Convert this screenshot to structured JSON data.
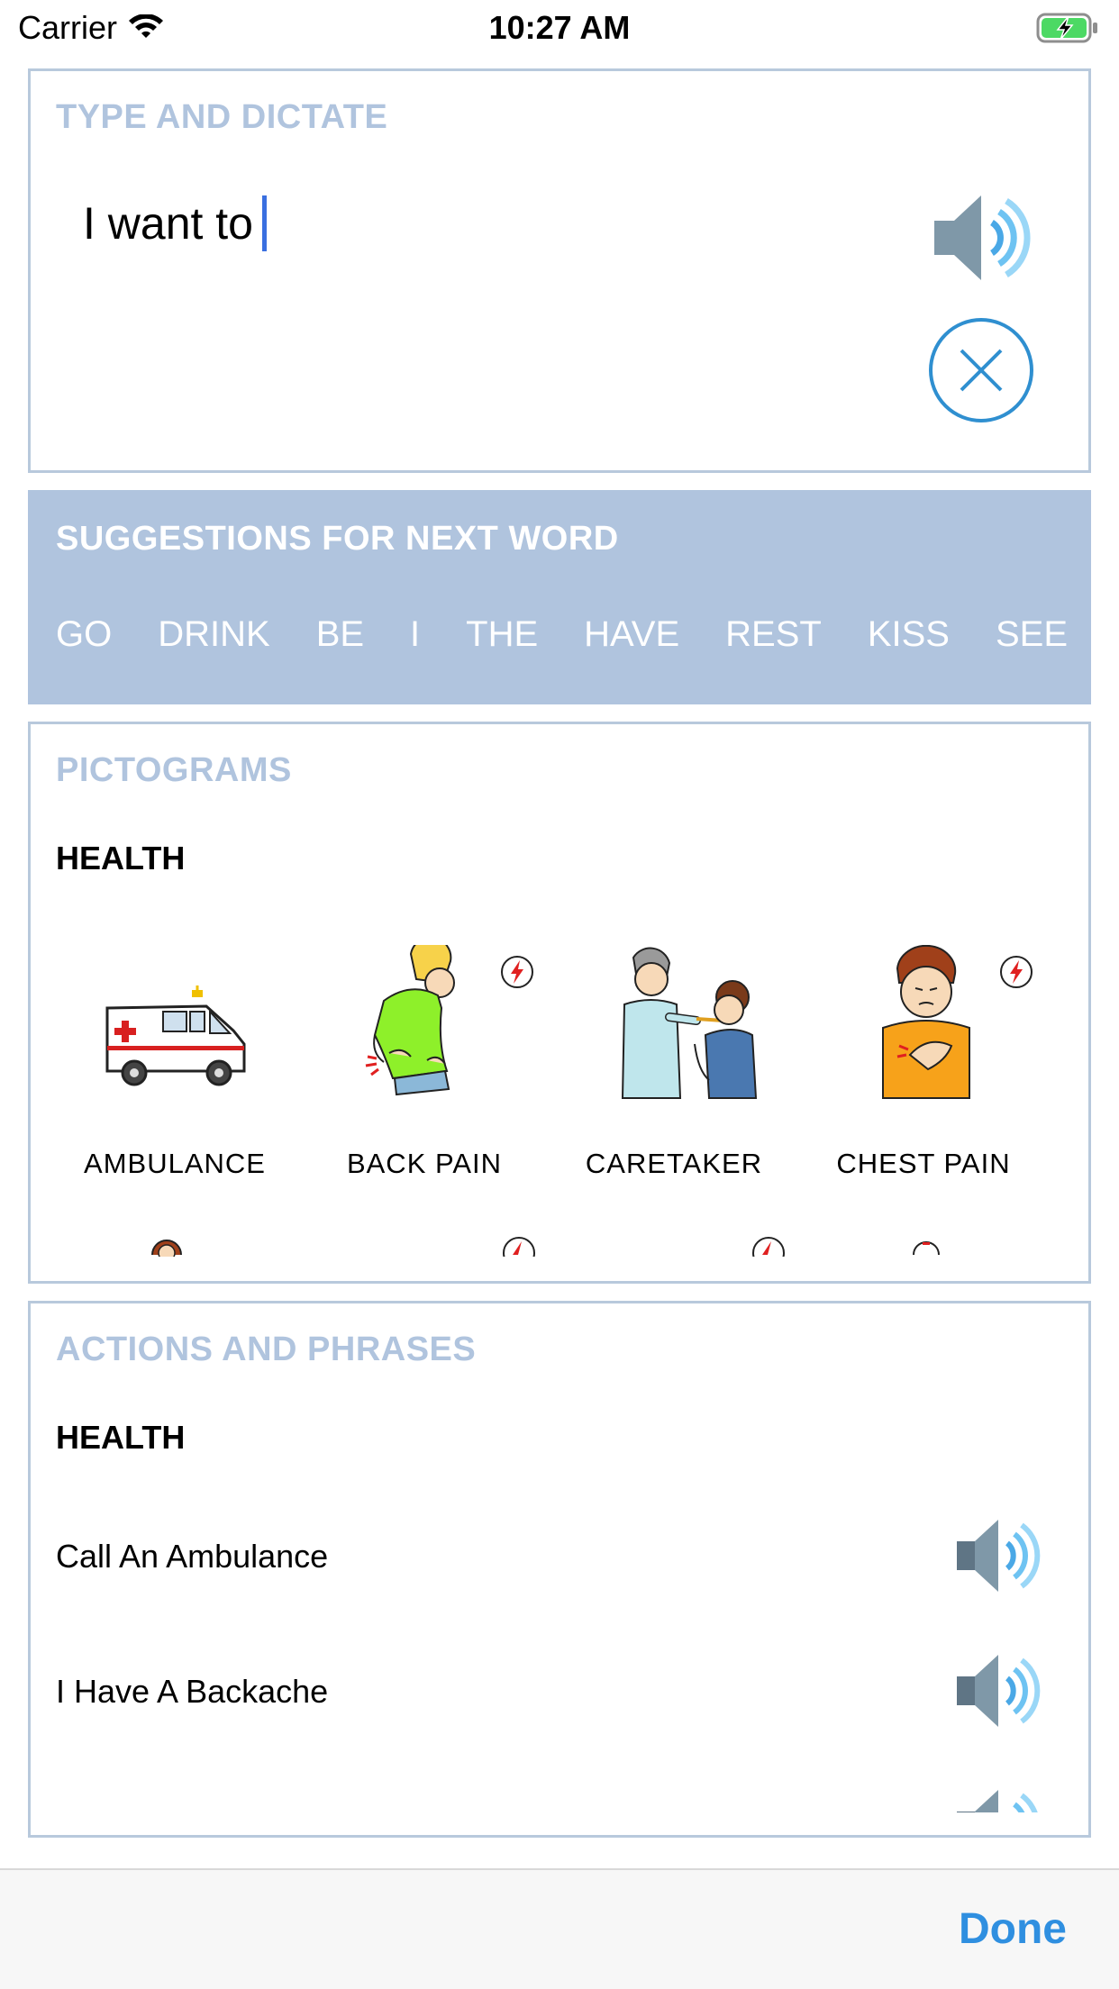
{
  "status_bar": {
    "carrier": "Carrier",
    "time": "10:27 AM",
    "wifi_icon": "wifi-icon",
    "battery_icon": "battery-charging-icon"
  },
  "type_card": {
    "title": "TYPE AND DICTATE",
    "text_value": "I want to",
    "speak_icon": "speaker-icon",
    "clear_icon": "close-circle-icon"
  },
  "suggestions": {
    "title": "SUGGESTIONS FOR NEXT WORD",
    "words": [
      "GO",
      "DRINK",
      "BE",
      "I",
      "THE",
      "HAVE",
      "REST",
      "KISS",
      "SEE"
    ]
  },
  "pictograms": {
    "title": "PICTOGRAMS",
    "category": "HEALTH",
    "items": [
      {
        "label": "AMBULANCE",
        "icon": "ambulance-icon"
      },
      {
        "label": "BACK PAIN",
        "icon": "back-pain-icon"
      },
      {
        "label": "CARETAKER",
        "icon": "caretaker-icon"
      },
      {
        "label": "CHEST PAIN",
        "icon": "chest-pain-icon"
      }
    ]
  },
  "actions": {
    "title": "ACTIONS AND PHRASES",
    "category": "HEALTH",
    "phrases": [
      {
        "text": "Call An Ambulance"
      },
      {
        "text": "I Have A Backache"
      }
    ]
  },
  "bottom_bar": {
    "done_label": "Done"
  },
  "colors": {
    "card_border": "#b8c9dc",
    "section_title": "#b0c4de",
    "accent_blue": "#2f8fe0",
    "caret": "#3a6fe0"
  }
}
